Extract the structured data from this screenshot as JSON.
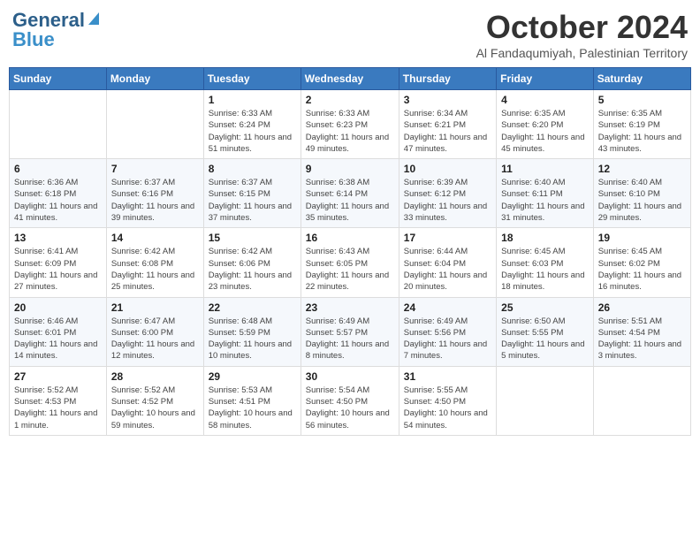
{
  "header": {
    "logo_line1": "General",
    "logo_line2": "Blue",
    "month_title": "October 2024",
    "subtitle": "Al Fandaqumiyah, Palestinian Territory"
  },
  "days_of_week": [
    "Sunday",
    "Monday",
    "Tuesday",
    "Wednesday",
    "Thursday",
    "Friday",
    "Saturday"
  ],
  "weeks": [
    [
      {
        "day": "",
        "info": ""
      },
      {
        "day": "",
        "info": ""
      },
      {
        "day": "1",
        "info": "Sunrise: 6:33 AM\nSunset: 6:24 PM\nDaylight: 11 hours and 51 minutes."
      },
      {
        "day": "2",
        "info": "Sunrise: 6:33 AM\nSunset: 6:23 PM\nDaylight: 11 hours and 49 minutes."
      },
      {
        "day": "3",
        "info": "Sunrise: 6:34 AM\nSunset: 6:21 PM\nDaylight: 11 hours and 47 minutes."
      },
      {
        "day": "4",
        "info": "Sunrise: 6:35 AM\nSunset: 6:20 PM\nDaylight: 11 hours and 45 minutes."
      },
      {
        "day": "5",
        "info": "Sunrise: 6:35 AM\nSunset: 6:19 PM\nDaylight: 11 hours and 43 minutes."
      }
    ],
    [
      {
        "day": "6",
        "info": "Sunrise: 6:36 AM\nSunset: 6:18 PM\nDaylight: 11 hours and 41 minutes."
      },
      {
        "day": "7",
        "info": "Sunrise: 6:37 AM\nSunset: 6:16 PM\nDaylight: 11 hours and 39 minutes."
      },
      {
        "day": "8",
        "info": "Sunrise: 6:37 AM\nSunset: 6:15 PM\nDaylight: 11 hours and 37 minutes."
      },
      {
        "day": "9",
        "info": "Sunrise: 6:38 AM\nSunset: 6:14 PM\nDaylight: 11 hours and 35 minutes."
      },
      {
        "day": "10",
        "info": "Sunrise: 6:39 AM\nSunset: 6:12 PM\nDaylight: 11 hours and 33 minutes."
      },
      {
        "day": "11",
        "info": "Sunrise: 6:40 AM\nSunset: 6:11 PM\nDaylight: 11 hours and 31 minutes."
      },
      {
        "day": "12",
        "info": "Sunrise: 6:40 AM\nSunset: 6:10 PM\nDaylight: 11 hours and 29 minutes."
      }
    ],
    [
      {
        "day": "13",
        "info": "Sunrise: 6:41 AM\nSunset: 6:09 PM\nDaylight: 11 hours and 27 minutes."
      },
      {
        "day": "14",
        "info": "Sunrise: 6:42 AM\nSunset: 6:08 PM\nDaylight: 11 hours and 25 minutes."
      },
      {
        "day": "15",
        "info": "Sunrise: 6:42 AM\nSunset: 6:06 PM\nDaylight: 11 hours and 23 minutes."
      },
      {
        "day": "16",
        "info": "Sunrise: 6:43 AM\nSunset: 6:05 PM\nDaylight: 11 hours and 22 minutes."
      },
      {
        "day": "17",
        "info": "Sunrise: 6:44 AM\nSunset: 6:04 PM\nDaylight: 11 hours and 20 minutes."
      },
      {
        "day": "18",
        "info": "Sunrise: 6:45 AM\nSunset: 6:03 PM\nDaylight: 11 hours and 18 minutes."
      },
      {
        "day": "19",
        "info": "Sunrise: 6:45 AM\nSunset: 6:02 PM\nDaylight: 11 hours and 16 minutes."
      }
    ],
    [
      {
        "day": "20",
        "info": "Sunrise: 6:46 AM\nSunset: 6:01 PM\nDaylight: 11 hours and 14 minutes."
      },
      {
        "day": "21",
        "info": "Sunrise: 6:47 AM\nSunset: 6:00 PM\nDaylight: 11 hours and 12 minutes."
      },
      {
        "day": "22",
        "info": "Sunrise: 6:48 AM\nSunset: 5:59 PM\nDaylight: 11 hours and 10 minutes."
      },
      {
        "day": "23",
        "info": "Sunrise: 6:49 AM\nSunset: 5:57 PM\nDaylight: 11 hours and 8 minutes."
      },
      {
        "day": "24",
        "info": "Sunrise: 6:49 AM\nSunset: 5:56 PM\nDaylight: 11 hours and 7 minutes."
      },
      {
        "day": "25",
        "info": "Sunrise: 6:50 AM\nSunset: 5:55 PM\nDaylight: 11 hours and 5 minutes."
      },
      {
        "day": "26",
        "info": "Sunrise: 5:51 AM\nSunset: 4:54 PM\nDaylight: 11 hours and 3 minutes."
      }
    ],
    [
      {
        "day": "27",
        "info": "Sunrise: 5:52 AM\nSunset: 4:53 PM\nDaylight: 11 hours and 1 minute."
      },
      {
        "day": "28",
        "info": "Sunrise: 5:52 AM\nSunset: 4:52 PM\nDaylight: 10 hours and 59 minutes."
      },
      {
        "day": "29",
        "info": "Sunrise: 5:53 AM\nSunset: 4:51 PM\nDaylight: 10 hours and 58 minutes."
      },
      {
        "day": "30",
        "info": "Sunrise: 5:54 AM\nSunset: 4:50 PM\nDaylight: 10 hours and 56 minutes."
      },
      {
        "day": "31",
        "info": "Sunrise: 5:55 AM\nSunset: 4:50 PM\nDaylight: 10 hours and 54 minutes."
      },
      {
        "day": "",
        "info": ""
      },
      {
        "day": "",
        "info": ""
      }
    ]
  ]
}
